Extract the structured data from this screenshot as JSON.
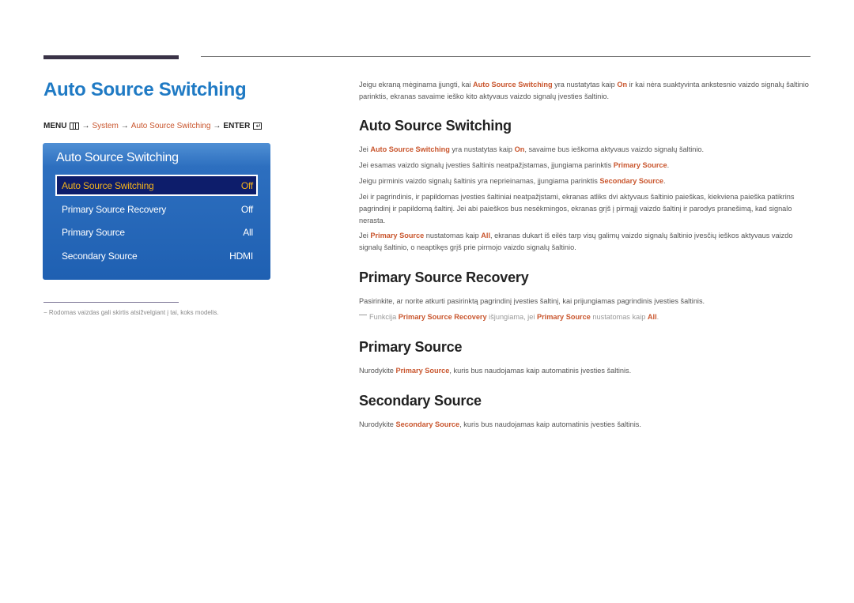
{
  "page": {
    "title": "Auto Source Switching",
    "menu_path": {
      "menu_label": "MENU",
      "menu_icon": "menu-grid-icon",
      "arrow": "→",
      "system": "System",
      "item": "Auto Source Switching",
      "enter_label": "ENTER",
      "enter_icon": "enter-icon"
    },
    "footnote": "Rodomas vaizdas gali skirtis atsižvelgiant į tai, koks modelis.",
    "footnote_dash": "−"
  },
  "osd": {
    "title": "Auto Source Switching",
    "items": [
      {
        "label": "Auto Source Switching",
        "value": "Off",
        "selected": true
      },
      {
        "label": "Primary Source Recovery",
        "value": "Off",
        "selected": false
      },
      {
        "label": "Primary Source",
        "value": "All",
        "selected": false
      },
      {
        "label": "Secondary Source",
        "value": "HDMI",
        "selected": false
      }
    ]
  },
  "content": {
    "intro": {
      "t1": "Jeigu ekraną mėginama įjungti, kai ",
      "b1": "Auto Source Switching",
      "t2": " yra nustatytas kaip ",
      "b2": "On",
      "t3": " ir kai nėra suaktyvinta ankstesnio vaizdo signalų šaltinio parinktis, ekranas savaime ieško kito aktyvaus vaizdo signalų įvesties šaltinio."
    },
    "sections": {
      "auto_source_switching": {
        "heading": "Auto Source Switching",
        "p1": {
          "t1": "Jei ",
          "b1": "Auto Source Switching",
          "t2": " yra nustatytas kaip ",
          "b2": "On",
          "t3": ", savaime bus ieškoma aktyvaus vaizdo signalų šaltinio."
        },
        "p2": {
          "t1": "Jei esamas vaizdo signalų įvesties šaltinis neatpažįstamas, įjungiama parinktis ",
          "b1": "Primary Source",
          "t2": "."
        },
        "p3": {
          "t1": "Jeigu pirminis vaizdo signalų šaltinis yra neprieinamas, įjungiama parinktis ",
          "b1": "Secondary Source",
          "t2": "."
        },
        "p4": "Jei ir pagrindinis, ir papildomas įvesties šaltiniai neatpažįstami, ekranas atliks dvi aktyvaus šaltinio paieškas, kiekviena paieška patikrins pagrindinį ir papildomą šaltinį. Jei abi paieškos bus nesėkmingos, ekranas grįš į pirmąjį vaizdo šaltinį ir parodys pranešimą, kad signalo nerasta.",
        "p5": {
          "t1": "Jei ",
          "b1": "Primary Source",
          "t2": " nustatomas kaip ",
          "b2": "All",
          "t3": ", ekranas dukart iš eilės tarp visų galimų vaizdo signalų šaltinio įvesčių ieškos aktyvaus vaizdo signalų šaltinio, o neaptikęs grįš prie pirmojo vaizdo signalų šaltinio."
        }
      },
      "primary_source_recovery": {
        "heading": "Primary Source Recovery",
        "p1": "Pasirinkite, ar norite atkurti pasirinktą pagrindinį įvesties šaltinį, kai prijungiamas pagrindinis įvesties šaltinis.",
        "note": {
          "t1": "Funkcija ",
          "b1": "Primary Source Recovery",
          "t2": " išjungiama, jei ",
          "b2": "Primary Source",
          "t3": " nustatomas kaip ",
          "b3": "All",
          "t4": "."
        }
      },
      "primary_source": {
        "heading": "Primary Source",
        "p1": {
          "t1": "Nurodykite ",
          "b1": "Primary Source",
          "t2": ", kuris bus naudojamas kaip automatinis įvesties šaltinis."
        }
      },
      "secondary_source": {
        "heading": "Secondary Source",
        "p1": {
          "t1": "Nurodykite ",
          "b1": "Secondary Source",
          "t2": ", kuris bus naudojamas kaip automatinis įvesties šaltinis."
        }
      }
    }
  },
  "colors": {
    "title_blue": "#1f7ac4",
    "highlight_orange": "#c9562e",
    "osd_blue": "#1f60b2",
    "osd_selected_bg": "#0d1d6b",
    "osd_selected_text": "#f2b21c"
  }
}
